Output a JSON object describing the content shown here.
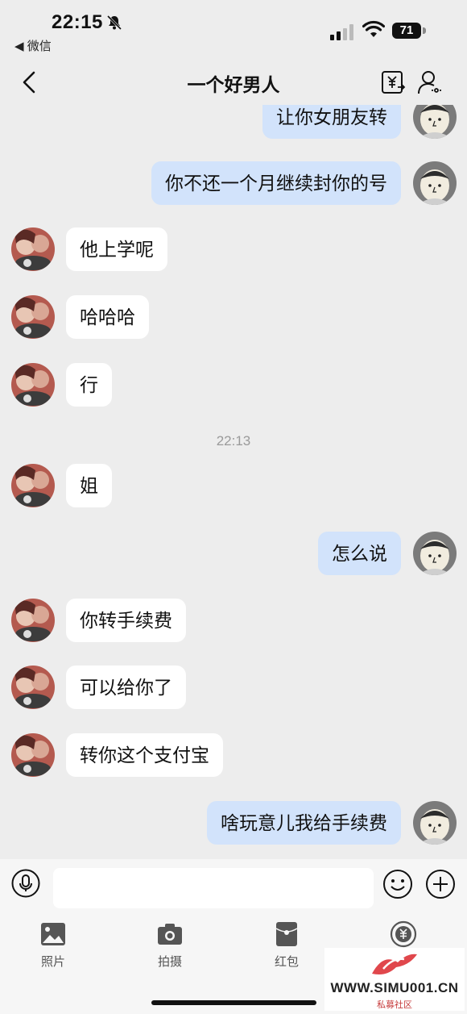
{
  "status": {
    "time": "22:15",
    "back_app": "◀ 微信",
    "battery": "71"
  },
  "header": {
    "title": "一个好男人"
  },
  "messages": [
    {
      "side": "out",
      "text": "让你女朋友转"
    },
    {
      "side": "out",
      "text": "你不还一个月继续封你的号"
    },
    {
      "side": "in",
      "text": "他上学呢"
    },
    {
      "side": "in",
      "text": "哈哈哈"
    },
    {
      "side": "in",
      "text": "行"
    },
    {
      "side": "time",
      "text": "22:13"
    },
    {
      "side": "in",
      "text": "姐"
    },
    {
      "side": "out",
      "text": "怎么说"
    },
    {
      "side": "in",
      "text": "你转手续费"
    },
    {
      "side": "in",
      "text": "可以给你了"
    },
    {
      "side": "in",
      "text": "转你这个支付宝"
    },
    {
      "side": "out",
      "text": "啥玩意儿我给手续费"
    }
  ],
  "input": {
    "value": ""
  },
  "tools": [
    {
      "label": "照片",
      "icon": "photo-icon"
    },
    {
      "label": "拍摄",
      "icon": "camera-icon"
    },
    {
      "label": "红包",
      "icon": "red-packet-icon"
    },
    {
      "label": "",
      "icon": "transfer-icon"
    }
  ],
  "watermark": {
    "text": "WWW.SIMU001.CN",
    "sub": "私募社区"
  }
}
